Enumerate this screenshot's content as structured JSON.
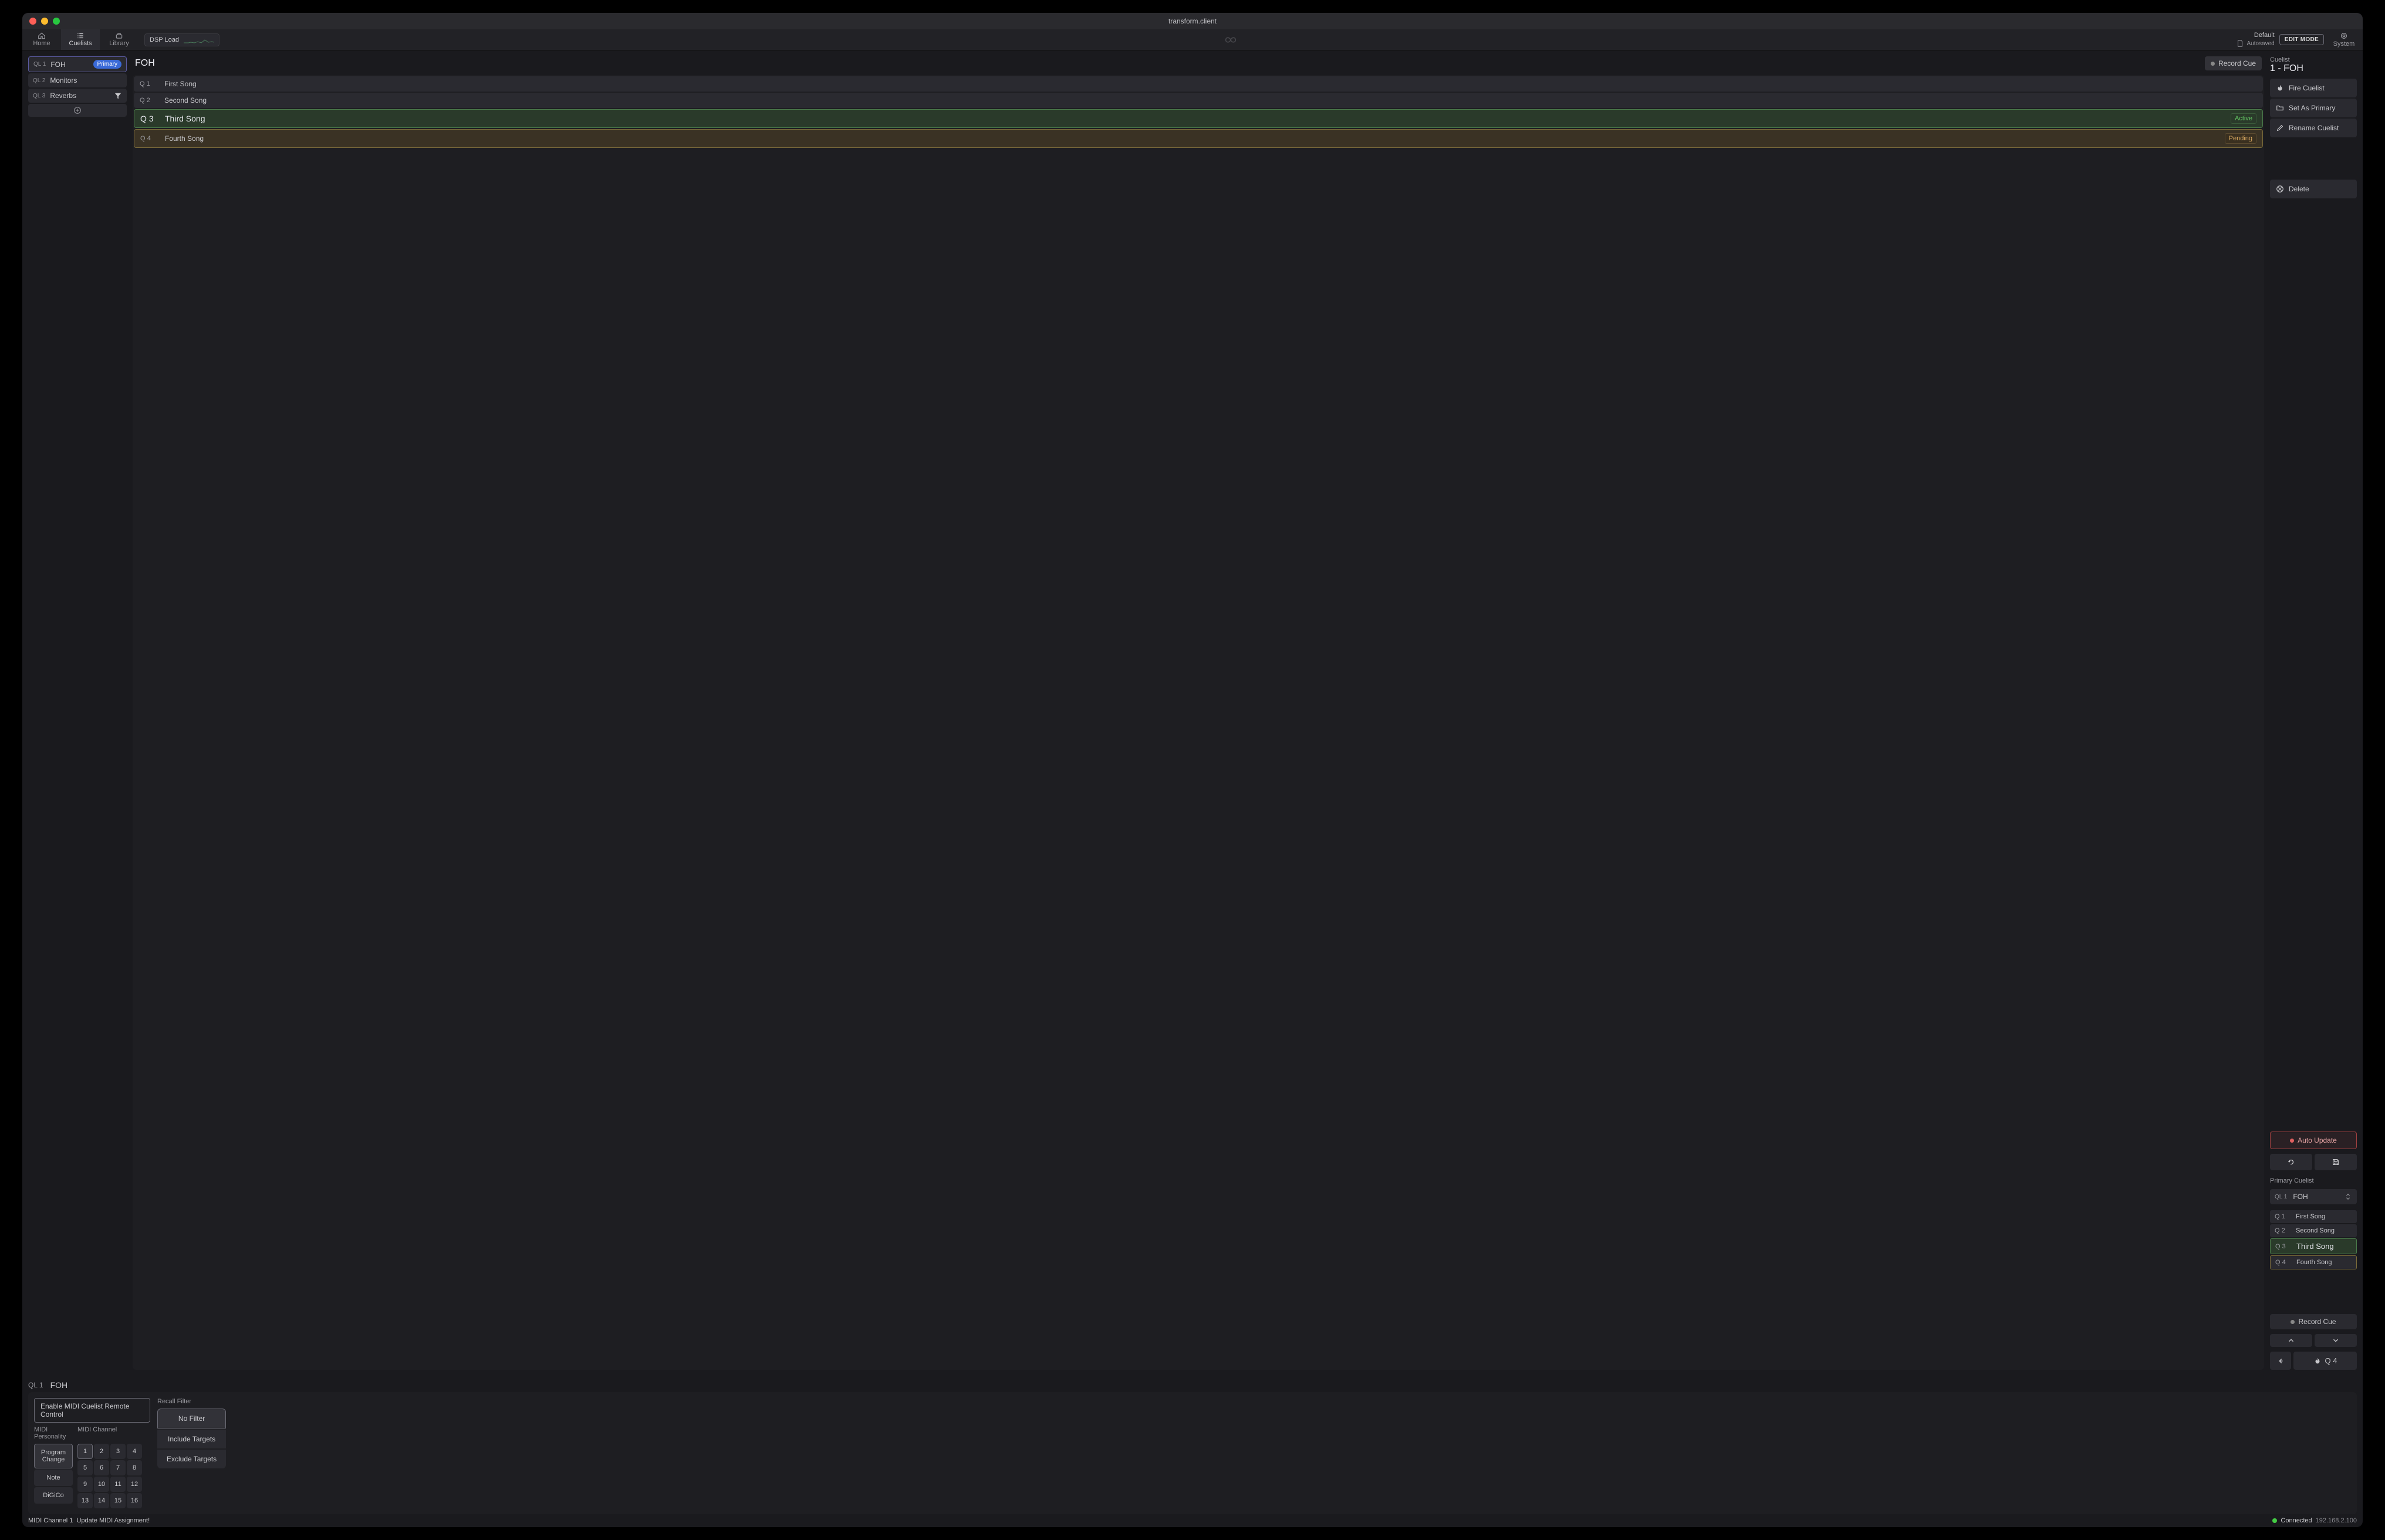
{
  "window": {
    "title": "transform.client"
  },
  "nav": {
    "home": "Home",
    "cuelists": "Cuelists",
    "library": "Library",
    "dsp_label": "DSP Load",
    "default": "Default",
    "autosaved": "Autosaved",
    "edit_mode": "EDIT MODE",
    "system": "System"
  },
  "sidebar": {
    "items": [
      {
        "ql": "QL 1",
        "name": "FOH",
        "primary": true
      },
      {
        "ql": "QL 2",
        "name": "Monitors"
      },
      {
        "ql": "QL 3",
        "name": "Reverbs",
        "filter": true
      }
    ]
  },
  "cues": {
    "title": "FOH",
    "record": "Record Cue",
    "rows": [
      {
        "q": "Q 1",
        "name": "First Song"
      },
      {
        "q": "Q 2",
        "name": "Second Song"
      },
      {
        "q": "Q 3",
        "name": "Third Song",
        "status": "Active"
      },
      {
        "q": "Q 4",
        "name": "Fourth Song",
        "status": "Pending"
      }
    ]
  },
  "inspector": {
    "head": "Cuelist",
    "title": "1 - FOH",
    "fire": "Fire Cuelist",
    "set_primary": "Set As Primary",
    "rename": "Rename Cuelist",
    "delete": "Delete",
    "auto_update": "Auto Update",
    "primary_label": "Primary Cuelist",
    "primary_ql": "QL 1",
    "primary_name": "FOH",
    "pc_rows": [
      {
        "q": "Q 1",
        "name": "First Song"
      },
      {
        "q": "Q 2",
        "name": "Second Song"
      },
      {
        "q": "Q 3",
        "name": "Third Song"
      },
      {
        "q": "Q 4",
        "name": "Fourth Song"
      }
    ],
    "record2": "Record Cue",
    "fire_q": "Q 4"
  },
  "bottom": {
    "ql": "QL 1",
    "name": "FOH",
    "remote": "Enable MIDI Cuelist Remote Control",
    "pers_label": "MIDI Personality",
    "chan_label": "MIDI Channel",
    "pers": [
      "Program Change",
      "Note",
      "DiGiCo"
    ],
    "channels": [
      "1",
      "2",
      "3",
      "4",
      "5",
      "6",
      "7",
      "8",
      "9",
      "10",
      "11",
      "12",
      "13",
      "14",
      "15",
      "16"
    ],
    "filter_label": "Recall Filter",
    "filters": [
      "No Filter",
      "Include Targets",
      "Exclude Targets"
    ]
  },
  "status": {
    "midi": "MIDI Channel 1",
    "update": "Update MIDI Assignment!",
    "connected": "Connected",
    "ip": "192.168.2.100"
  }
}
